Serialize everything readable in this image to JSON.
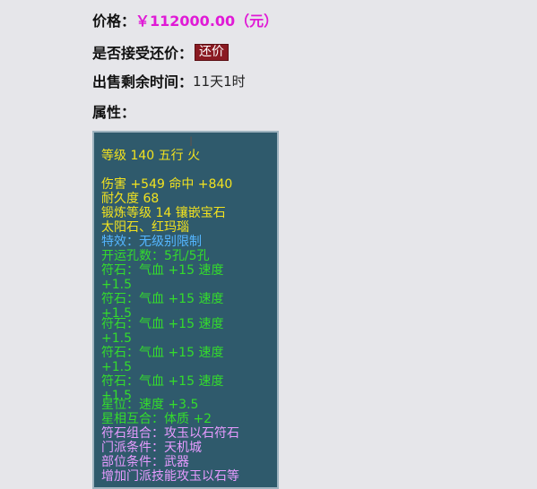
{
  "price": {
    "label": "价格：",
    "value": "￥112000.00（元）"
  },
  "bargain": {
    "label": "是否接受还价：",
    "badge": "还价"
  },
  "remaining": {
    "label": "出售剩余时间：",
    "value": "11天1时"
  },
  "attributes_label": "属性：",
  "tooltip": {
    "lines": [
      {
        "text": "等级 140 五行 火",
        "color": "yellow"
      },
      {
        "text": "伤害 +549 命中 +840",
        "color": "yellow"
      },
      {
        "text": "耐久度 68",
        "color": "yellow"
      },
      {
        "text": "锻炼等级 14 镶嵌宝石",
        "color": "yellow"
      },
      {
        "text": "太阳石、红玛瑙",
        "color": "yellow"
      },
      {
        "text": "特效：无级别限制",
        "color": "cyan"
      },
      {
        "text": "开运孔数：5孔/5孔",
        "color": "green"
      },
      {
        "text": "符石：气血 +15 速度",
        "color": "green"
      },
      {
        "text": "+1.5",
        "color": "green"
      },
      {
        "text": "符石：气血 +15 速度",
        "color": "green"
      },
      {
        "text": "+1.5",
        "color": "green"
      },
      {
        "text": "符石：气血 +15 速度",
        "color": "green"
      },
      {
        "text": "+1.5",
        "color": "green"
      },
      {
        "text": "符石：气血 +15 速度",
        "color": "green"
      },
      {
        "text": "+1.5",
        "color": "green"
      },
      {
        "text": "符石：气血 +15 速度",
        "color": "green"
      },
      {
        "text": "+1.5",
        "color": "green"
      },
      {
        "text": "星位：速度 +3.5",
        "color": "green"
      },
      {
        "text": "星相互合：体质 +2",
        "color": "green"
      },
      {
        "text": "符石组合：攻玉以石符石",
        "color": "pink"
      },
      {
        "text": "门派条件：天机城",
        "color": "pink"
      },
      {
        "text": "部位条件：武器",
        "color": "pink"
      },
      {
        "text": "增加门派技能攻玉以石等",
        "color": "pink"
      }
    ]
  }
}
